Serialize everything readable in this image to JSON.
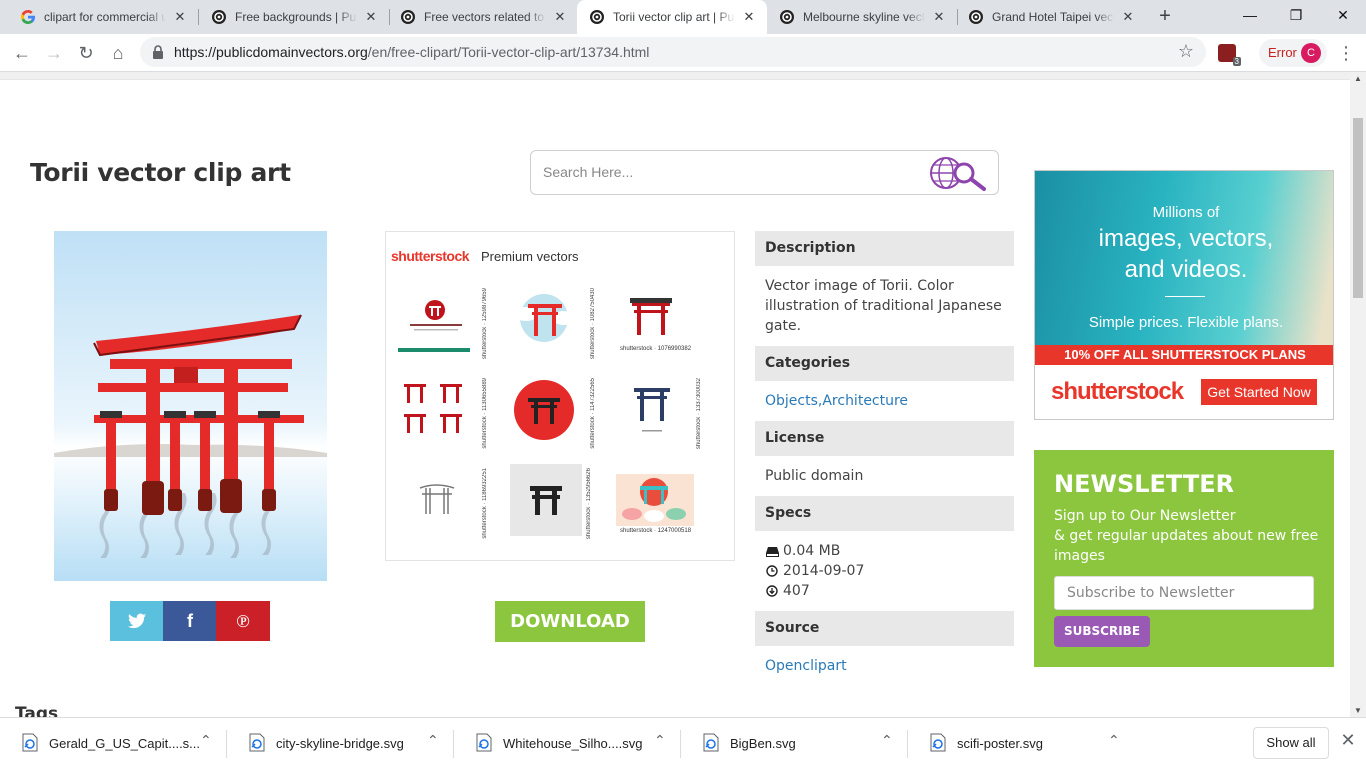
{
  "browser": {
    "tabs": [
      {
        "label": "clipart for commercial use",
        "icon": "google-g-icon"
      },
      {
        "label": "Free backgrounds | Public",
        "icon": "pdv-icon"
      },
      {
        "label": "Free vectors related to c",
        "icon": "pdv-icon"
      },
      {
        "label": "Torii vector clip art | Pub",
        "icon": "pdv-icon",
        "active": true
      },
      {
        "label": "Melbourne skyline vector",
        "icon": "pdv-icon"
      },
      {
        "label": "Grand Hotel Taipei vector",
        "icon": "pdv-icon"
      }
    ],
    "url_host": "https://publicdomainvectors.org",
    "url_path": "/en/free-clipart/Torii-vector-clip-art/13734.html",
    "extension_badge": "3",
    "error_label": "Error",
    "avatar_letter": "C"
  },
  "page": {
    "title": "Torii vector clip art",
    "search_placeholder": "Search Here...",
    "premium": {
      "brand": "shutterstock",
      "label": "Premium vectors",
      "watermarks": [
        "shutterstock · 1259879659",
        "shutterstock · 1082750430",
        "shutterstock · 1076990382",
        "shutterstock · 1130655889",
        "shutterstock · 1147322565",
        "shutterstock · 1337300032",
        "shutterstock · 1186932251",
        "shutterstock · 1352956626",
        "shutterstock · 1247000518"
      ]
    },
    "download_label": "DOWNLOAD",
    "description": {
      "header": "Description",
      "text": "Vector image of Torii. Color illustration of traditional Japanese gate."
    },
    "categories": {
      "header": "Categories",
      "text": "Objects,Architecture"
    },
    "license": {
      "header": "License",
      "text": "Public domain"
    },
    "specs": {
      "header": "Specs",
      "size": "0.04 MB",
      "date": "2014-09-07",
      "downloads": "407"
    },
    "source": {
      "header": "Source",
      "text": "Openclipart"
    },
    "tags_heading": "Tags",
    "ad": {
      "line1": "Millions of",
      "line2": "images, vectors,",
      "line3": "and videos.",
      "line4": "Simple prices. Flexible plans.",
      "band": "10% OFF ALL SHUTTERSTOCK PLANS",
      "brand": "shutterstock",
      "cta": "Get Started Now"
    },
    "newsletter": {
      "heading": "NEWSLETTER",
      "line1": "Sign up to Our Newsletter",
      "line2": "& get regular updates about new free images",
      "placeholder": "Subscribe to Newsletter",
      "button": "SUBSCRIBE"
    }
  },
  "downloads": {
    "items": [
      "Gerald_G_US_Capit....s...",
      "city-skyline-bridge.svg",
      "Whitehouse_Silho....svg",
      "BigBen.svg",
      "scifi-poster.svg"
    ],
    "show_all": "Show all"
  },
  "colors": {
    "accent_green": "#8cc63f",
    "shutterstock_red": "#e9362b",
    "torii_red": "#e52a2a",
    "purple": "#9b59b6"
  }
}
